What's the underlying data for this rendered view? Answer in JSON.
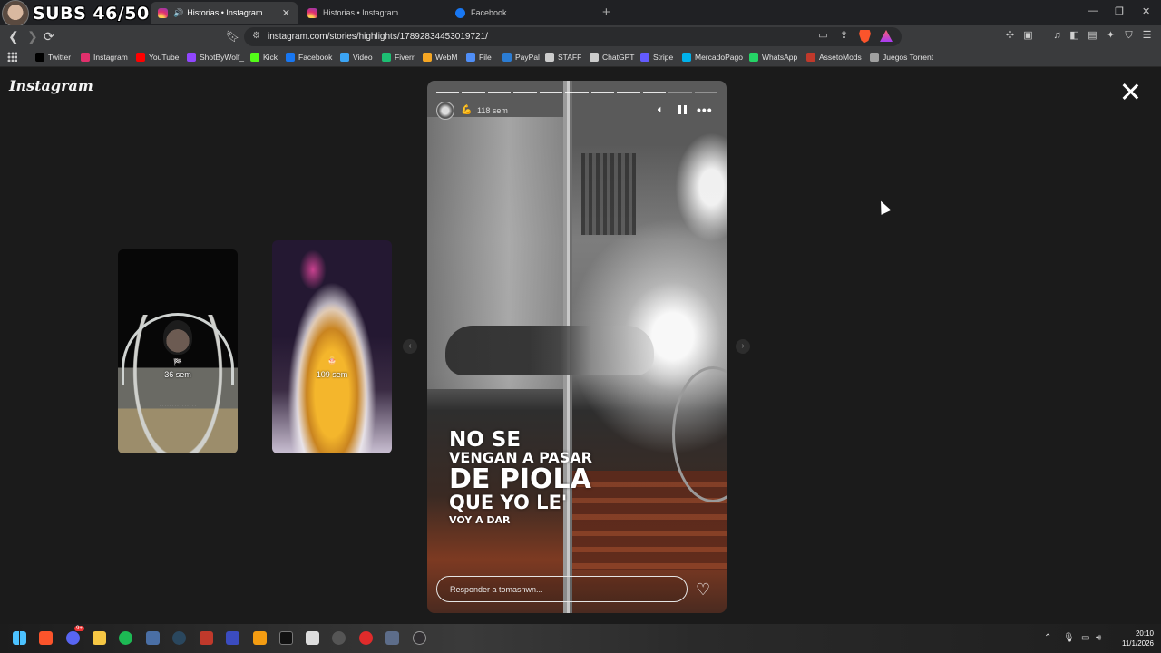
{
  "overlay": {
    "subs_text": "SUBS 46/50"
  },
  "browser": {
    "tabs": [
      {
        "title": "Historias • Instagram",
        "icon": "instagram-icon",
        "audio": true,
        "active": true
      },
      {
        "title": "Historias • Instagram",
        "icon": "instagram-icon",
        "audio": false,
        "active": false
      },
      {
        "title": "Facebook",
        "icon": "facebook-icon",
        "audio": false,
        "active": false
      }
    ],
    "url": "instagram.com/stories/highlights/17892834453019721/",
    "bookmarks": [
      {
        "label": "Twitter",
        "icon": "x-icon",
        "color": "#000000"
      },
      {
        "label": "Instagram",
        "icon": "instagram-icon",
        "color": "#e1306c"
      },
      {
        "label": "YouTube",
        "icon": "youtube-icon",
        "color": "#ff0000"
      },
      {
        "label": "ShotByWolf_",
        "icon": "twitch-icon",
        "color": "#9146ff"
      },
      {
        "label": "Kick",
        "icon": "kick-icon",
        "color": "#53fc18"
      },
      {
        "label": "Facebook",
        "icon": "facebook-icon",
        "color": "#1877f2"
      },
      {
        "label": "Video",
        "icon": "video-icon",
        "color": "#3ba4f5"
      },
      {
        "label": "Fiverr",
        "icon": "fiverr-icon",
        "color": "#1dbf73"
      },
      {
        "label": "WebM",
        "icon": "webm-icon",
        "color": "#f5a623"
      },
      {
        "label": "File",
        "icon": "file-icon",
        "color": "#4f8ef7"
      },
      {
        "label": "PayPal",
        "icon": "paypal-icon",
        "color": "#2b7cd3"
      },
      {
        "label": "STAFF",
        "icon": "folder-icon",
        "color": "#cccccc"
      },
      {
        "label": "ChatGPT",
        "icon": "chatgpt-icon",
        "color": "#cccccc"
      },
      {
        "label": "Stripe",
        "icon": "stripe-icon",
        "color": "#635bff"
      },
      {
        "label": "MercadoPago",
        "icon": "mercadopago-icon",
        "color": "#00b1ea"
      },
      {
        "label": "WhatsApp",
        "icon": "whatsapp-icon",
        "color": "#25d366"
      },
      {
        "label": "AssetoMods",
        "icon": "assetomods-icon",
        "color": "#c0392b"
      },
      {
        "label": "Juegos Torrent",
        "icon": "torrent-icon",
        "color": "#a0a0a0"
      }
    ]
  },
  "page": {
    "logo": "Instagram",
    "previews": [
      {
        "time": "36 sem",
        "emoji": "🏁"
      },
      {
        "time": "109 sem",
        "emoji": "🎂"
      }
    ],
    "story": {
      "time": "118 sem",
      "emoji": "💪",
      "text_lines": [
        "NO SE",
        "VENGAN A PASAR",
        "DE PIOLA",
        "QUE YO LE'",
        "VOY A DAR"
      ],
      "reply_placeholder": "Responder a tomasnwn..."
    }
  },
  "taskbar": {
    "time": "20:10",
    "date": "11/1/2026",
    "discord_badge": "9+"
  }
}
